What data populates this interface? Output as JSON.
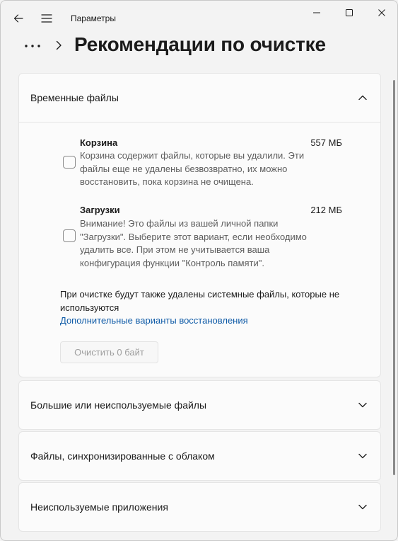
{
  "titlebar": {
    "app_title": "Параметры"
  },
  "header": {
    "page_title": "Рекомендации по очистке"
  },
  "temp_files": {
    "label": "Временные файлы",
    "expanded": true,
    "items": [
      {
        "title": "Корзина",
        "size": "557 МБ",
        "checked": false,
        "description": "Корзина содержит файлы, которые вы удалили. Эти файлы еще не удалены безвозвратно, их можно восстановить, пока корзина не очищена."
      },
      {
        "title": "Загрузки",
        "size": "212 МБ",
        "checked": false,
        "description": "Внимание! Это файлы из вашей личной папки \"Загрузки\". Выберите этот вариант, если необходимо удалить все. При этом не учитывается ваша конфигурация функции \"Контроль памяти\"."
      }
    ],
    "notice": "При очистке будут также удалены системные файлы, которые не используются",
    "link": "Дополнительные варианты восстановления",
    "clean_button": "Очистить 0 байт"
  },
  "sections": [
    {
      "label": "Большие или неиспользуемые файлы",
      "expanded": false
    },
    {
      "label": "Файлы, синхронизированные с облаком",
      "expanded": false
    },
    {
      "label": "Неиспользуемые приложения",
      "expanded": false
    }
  ],
  "colors": {
    "background": "#f3f3f3",
    "card": "#fbfbfb",
    "link": "#0f5ba7",
    "disabled_text": "#9e9e9e"
  },
  "icons": {
    "back": "back-arrow-icon",
    "menu": "hamburger-menu-icon",
    "minimize": "minimize-icon",
    "maximize": "maximize-icon",
    "close": "close-icon",
    "more": "more-dots-icon",
    "breadcrumb_separator": "chevron-right-icon",
    "collapse": "chevron-up-icon",
    "expand": "chevron-down-icon"
  }
}
